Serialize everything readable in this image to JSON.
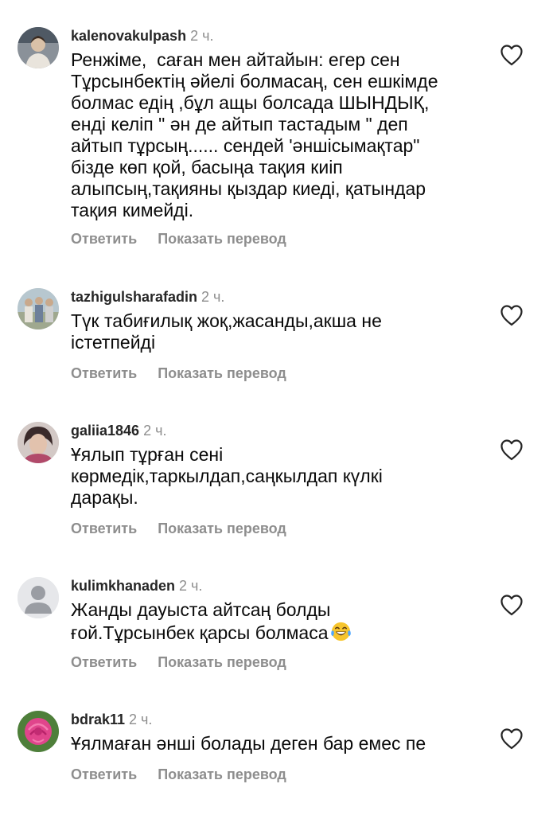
{
  "comments": [
    {
      "username": "kalenovakulpash",
      "time": "2 ч.",
      "text": "Ренжіме,  саған мен айтайын: егер сен\nТұрсынбектің әйелі болмасаң, сен ешкімде\nболмас едің ,бұл ащы болсада ШЫНДЫҚ,\nенді келіп \" ән де айтып тастадым \" деп\nайтып тұрсың...... сендей 'әншісымақтар\"\nбізде көп қой, басыңа тақия киіп\nалыпсың,тақияны қыздар киеді, қатындар\nтақия кимейді.",
      "reply": "Ответить",
      "translate": "Показать перевод",
      "avatar_icon": "user-photo-avatar"
    },
    {
      "username": "tazhigulsharafadin",
      "time": "2 ч.",
      "text": "Түк табиғилық жоқ,жасанды,акша не\nістетпейді",
      "reply": "Ответить",
      "translate": "Показать перевод",
      "avatar_icon": "group-photo-avatar"
    },
    {
      "username": "galiia1846",
      "time": "2 ч.",
      "text": "Ұялып тұрған сені\nкөрмедік,таркылдап,саңкылдап күлкі\nдарақы.",
      "reply": "Ответить",
      "translate": "Показать перевод",
      "avatar_icon": "user-photo-avatar"
    },
    {
      "username": "kulimkhanaden",
      "time": "2 ч.",
      "text": "Жанды дауыста айтсаң болды\nғой.Тұрсынбек қарсы болмаса",
      "emoji": "laughing-tears-emoji",
      "reply": "Ответить",
      "translate": "Показать перевод",
      "avatar_icon": "default-user-avatar"
    },
    {
      "username": "bdrak11",
      "time": "2 ч.",
      "text": "Ұялмаған әнші болады деген бар емес пе",
      "reply": "Ответить",
      "translate": "Показать перевод",
      "avatar_icon": "rose-photo-avatar"
    }
  ],
  "icons": {
    "like": "heart-outline-icon"
  },
  "colors": {
    "username": "#262626",
    "secondary_text": "#8e8e8e",
    "body_text": "#0a0a0a",
    "background": "#ffffff"
  }
}
